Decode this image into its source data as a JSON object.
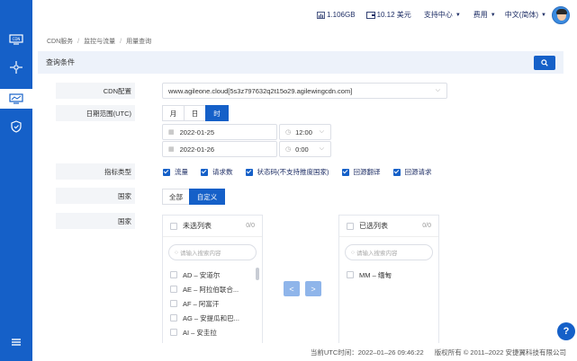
{
  "topbar": {
    "traffic": "1.106GB",
    "balance": "10.12 美元",
    "support": "支持中心",
    "billing": "费用",
    "language": "中文(简体)"
  },
  "sidebar": {
    "icons": [
      "cdn-icon",
      "network-node-icon",
      "monitor-icon",
      "shield-icon",
      "menu-icon"
    ]
  },
  "breadcrumb": [
    "CDN服务",
    "监控与流量",
    "用量查询"
  ],
  "query": {
    "title": "查询条件",
    "cdn_label": "CDN配置",
    "cdn_value": "www.agileone.cloud[5s3z797632q2t15o29.agilewingcdn.com]",
    "date_label": "日期范围(UTC)",
    "date_tabs": [
      "月",
      "日",
      "时"
    ],
    "date_tab_selected": "时",
    "start_date": "2022-01-25",
    "start_time": "12:00",
    "end_date": "2022-01-26",
    "end_time": "0:00",
    "metric_label": "指标类型",
    "metrics": [
      "流量",
      "请求数",
      "状态码(不支持推度国家)",
      "回源翻译",
      "回源请求"
    ],
    "country_label": "国家",
    "country_tabs": [
      "全部",
      "自定义"
    ],
    "country_tab_selected": "自定义",
    "country_label2": "国家"
  },
  "transfer": {
    "left_title": "未选列表",
    "left_count": "0/0",
    "left_placeholder": "请输入搜索内容",
    "left_items": [
      "AD – 安道尔",
      "AE – 阿拉伯联合...",
      "AF – 阿富汗",
      "AG – 安提瓜和巴...",
      "AI – 安圭拉"
    ],
    "right_title": "已选列表",
    "right_count": "0/0",
    "right_placeholder": "请输入搜索内容",
    "right_items": [
      "MM – 缅甸"
    ],
    "move_left": "<",
    "move_right": ">"
  },
  "footer": {
    "time": "当前UTC时间：2022–01–26 09:46:22",
    "copyright": "版权所有 © 2011–2022 安捷翼科技有限公司"
  },
  "colors": {
    "primary": "#1560c8",
    "sidebar": "#1560c8"
  }
}
